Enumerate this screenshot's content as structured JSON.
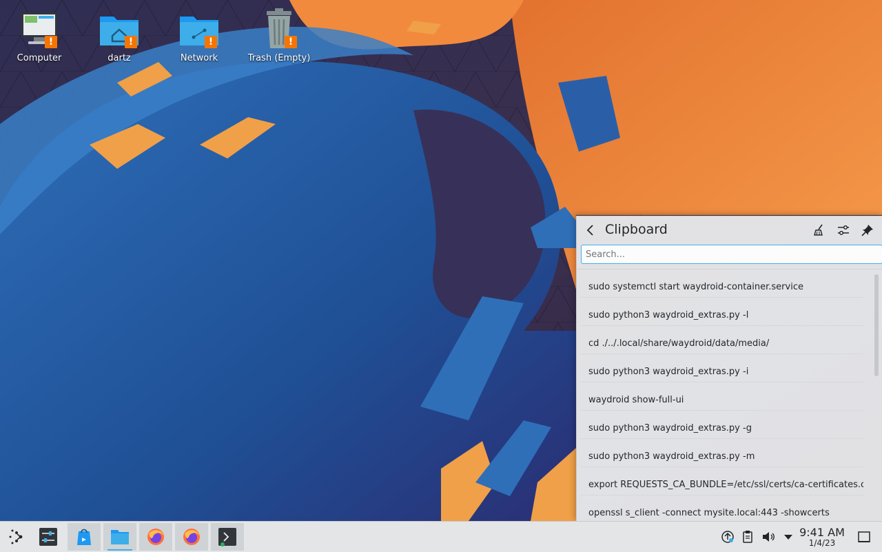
{
  "desktop": {
    "icons": [
      {
        "label": "Computer"
      },
      {
        "label": "dartz"
      },
      {
        "label": "Network"
      },
      {
        "label": "Trash (Empty)"
      }
    ],
    "badge_glyph": "!"
  },
  "clipboard": {
    "title": "Clipboard",
    "search_placeholder": "Search...",
    "items": [
      "sudo systemctl start waydroid-container.service",
      "sudo python3 waydroid_extras.py -l",
      "cd ./../.local/share/waydroid/data/media/",
      "sudo python3 waydroid_extras.py -i",
      "waydroid show-full-ui",
      "sudo python3 waydroid_extras.py -g",
      "sudo python3 waydroid_extras.py -m",
      "export REQUESTS_CA_BUNDLE=/etc/ssl/certs/ca-certificates.crt",
      "openssl s_client -connect mysite.local:443 -showcerts"
    ],
    "header_icons": [
      "broom-icon",
      "sliders-icon",
      "pin-icon"
    ]
  },
  "taskbar": {
    "apps": [
      "app-launcher-icon",
      "system-settings-icon",
      "discover-icon",
      "dolphin-icon",
      "firefox-icon",
      "firefox-icon",
      "konsole-icon"
    ],
    "tray": [
      "updates-icon",
      "clipboard-icon",
      "volume-icon",
      "expand-arrow-icon",
      "show-desktop-icon"
    ],
    "clock_time": "9:41 AM",
    "clock_date": "1/4/23"
  },
  "colors": {
    "accent": "#3daee9",
    "warning": "#f67400",
    "panel_bg": "#e3e5e7",
    "wallpaper_orange": "#f28a3d",
    "wallpaper_blue": "#2a66b0"
  }
}
